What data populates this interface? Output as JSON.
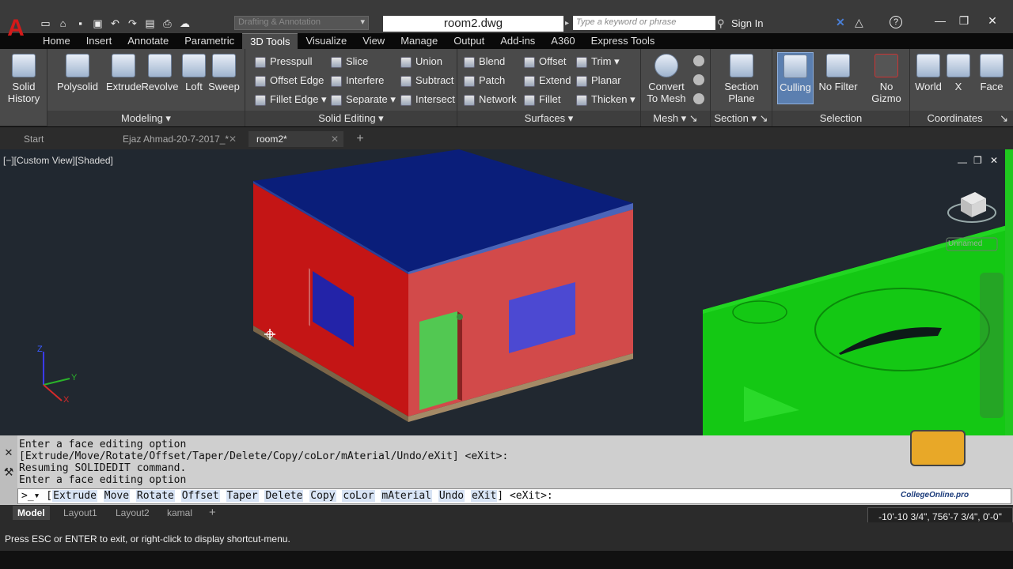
{
  "title": {
    "app_logo": "A",
    "workspace": "Drafting & Annotation",
    "document": "room2.dwg",
    "search_placeholder": "Type a keyword or phrase",
    "sign_in": "Sign In"
  },
  "ribbon_tabs": [
    "Home",
    "Insert",
    "Annotate",
    "Parametric",
    "3D Tools",
    "Visualize",
    "View",
    "Manage",
    "Output",
    "Add-ins",
    "A360",
    "Express Tools"
  ],
  "ribbon": {
    "solid_history": [
      "Solid",
      "History"
    ],
    "modeling": {
      "title": "Modeling",
      "items": [
        "Polysolid",
        "Extrude",
        "Revolve",
        "Loft",
        "Sweep"
      ]
    },
    "solid_editing": {
      "title": "Solid Editing",
      "col1": [
        "Presspull",
        "Offset Edge",
        "Fillet Edge"
      ],
      "col2": [
        "Slice",
        "Interfere",
        "Separate"
      ],
      "col3": [
        "Union",
        "Subtract",
        "Intersect"
      ]
    },
    "surfaces": {
      "title": "Surfaces",
      "col1": [
        "Blend",
        "Patch",
        "Network"
      ],
      "col2": [
        "Offset",
        "Extend",
        "Fillet"
      ],
      "col3": [
        "Trim",
        "Planar",
        "Thicken"
      ]
    },
    "mesh": {
      "title": "Mesh",
      "convert": [
        "Convert",
        "To Mesh"
      ]
    },
    "section": {
      "title": "Section",
      "plane": [
        "Section",
        "Plane"
      ]
    },
    "selection": {
      "title": "Selection",
      "culling": "Culling",
      "no_filter": "No Filter",
      "no_gizmo": [
        "No",
        "Gizmo"
      ]
    },
    "coordinates": {
      "title": "Coordinates",
      "world": "World",
      "x": "X",
      "face": "Face"
    }
  },
  "doc_tabs": [
    "Start",
    "Ejaz Ahmad-20-7-2017_*",
    "room2*"
  ],
  "viewport": {
    "label": "[−][Custom View][Shaded]",
    "viewcube_label": "Unnamed",
    "axis_z": "Z",
    "axis_y": "Y",
    "axis_x": "X"
  },
  "command": {
    "history": [
      "Enter a face editing option",
      "[Extrude/Move/Rotate/Offset/Taper/Delete/Copy/coLor/mAterial/Undo/eXit] <eXit>:",
      "Resuming SOLIDEDIT command.",
      "Enter a face editing option"
    ],
    "options": [
      "Extrude",
      "Move",
      "Rotate",
      "Offset",
      "Taper",
      "Delete",
      "Copy",
      "coLor",
      "mAterial",
      "Undo",
      "eXit"
    ],
    "suffix": "<eXit>:",
    "watermark": "CollegeOnline.pro"
  },
  "layout_tabs": [
    "Model",
    "Layout1",
    "Layout2",
    "kamal"
  ],
  "coordinates": "-10'-10 3/4\", 756'-7 3/4\", 0'-0\"",
  "status_text": "Press ESC or ENTER to exit, or right-click to display shortcut-menu.",
  "colors": {
    "roof": "#0a1e7a",
    "wall": "#d23a3a",
    "wall_dark": "#b81414",
    "window": "#4a4ad0",
    "door": "#52c852",
    "green_object": "#14c814",
    "viewport_bg": "#212830"
  }
}
